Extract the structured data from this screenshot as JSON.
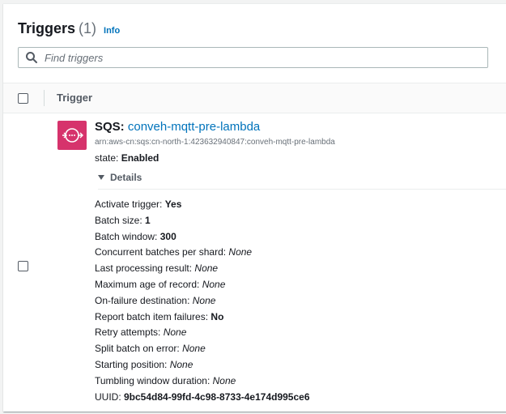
{
  "header": {
    "title": "Triggers",
    "count": "(1)",
    "info_label": "Info"
  },
  "search": {
    "placeholder": "Find triggers",
    "value": ""
  },
  "table": {
    "column_trigger": "Trigger"
  },
  "trigger": {
    "service": "SQS:",
    "name": "conveh-mqtt-pre-lambda",
    "arn": "arn:aws-cn:sqs:cn-north-1:423632940847:conveh-mqtt-pre-lambda",
    "state_label": "state:",
    "state_value": "Enabled",
    "details_label": "Details",
    "properties": [
      {
        "key": "Activate trigger:",
        "value": "Yes",
        "style": "bold"
      },
      {
        "key": "Batch size:",
        "value": "1",
        "style": "bold"
      },
      {
        "key": "Batch window:",
        "value": "300",
        "style": "bold"
      },
      {
        "key": "Concurrent batches per shard:",
        "value": "None",
        "style": "italic"
      },
      {
        "key": "Last processing result:",
        "value": "None",
        "style": "italic"
      },
      {
        "key": "Maximum age of record:",
        "value": "None",
        "style": "italic"
      },
      {
        "key": "On-failure destination:",
        "value": "None",
        "style": "italic"
      },
      {
        "key": "Report batch item failures:",
        "value": "No",
        "style": "bold"
      },
      {
        "key": "Retry attempts:",
        "value": "None",
        "style": "italic"
      },
      {
        "key": "Split batch on error:",
        "value": "None",
        "style": "italic"
      },
      {
        "key": "Starting position:",
        "value": "None",
        "style": "italic"
      },
      {
        "key": "Tumbling window duration:",
        "value": "None",
        "style": "italic"
      },
      {
        "key": "UUID:",
        "value": "9bc54d84-99fd-4c98-8733-4e174d995ce6",
        "style": "bold"
      }
    ]
  },
  "colors": {
    "link": "#0073bb",
    "sqs_icon": "#d6336c",
    "muted": "#687078"
  },
  "icons": {
    "search": "search-icon",
    "sqs": "sqs-icon",
    "caret": "caret-down-icon"
  }
}
